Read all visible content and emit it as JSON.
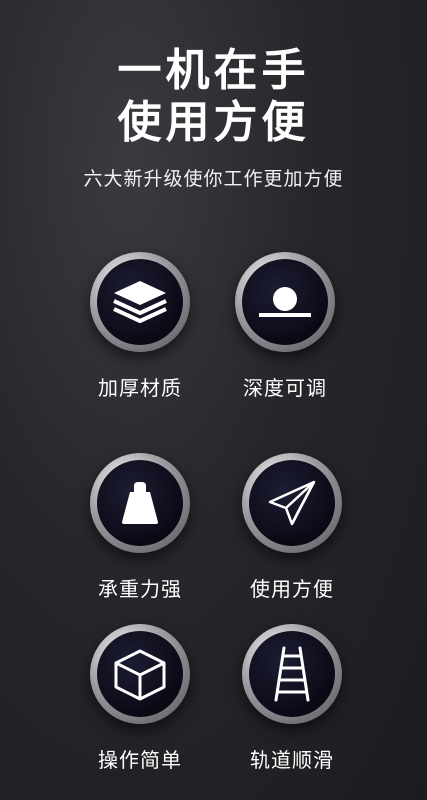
{
  "header": {
    "line1": "一机在手",
    "line2": "使用方便",
    "subtitle": "六大新升级使你工作更加方便"
  },
  "features": [
    {
      "label": "加厚材质",
      "icon": "layers-icon"
    },
    {
      "label": "深度可调",
      "icon": "ball-on-line-icon"
    },
    {
      "label": "承重力强",
      "icon": "weight-icon"
    },
    {
      "label": "使用方便",
      "icon": "paper-plane-icon"
    },
    {
      "label": "操作简单",
      "icon": "cube-icon"
    },
    {
      "label": "轨道顺滑",
      "icon": "ladder-icon"
    }
  ]
}
